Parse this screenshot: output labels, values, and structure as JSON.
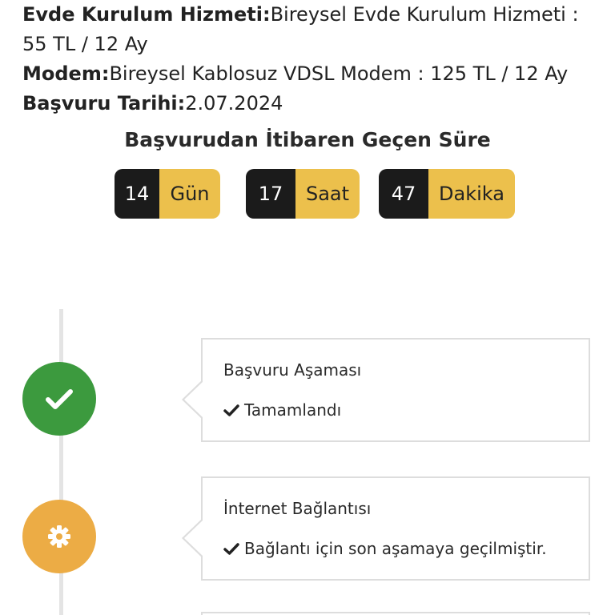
{
  "info": {
    "install_label": "Evde Kurulum Hizmeti:",
    "install_value": "Bireysel Evde Kurulum Hizmeti :",
    "install_value_cont": "55 TL / 12 Ay",
    "modem_label": "Modem:",
    "modem_value": "Bireysel Kablosuz VDSL Modem : 125 TL / 12 Ay",
    "date_label": "Başvuru Tarihi:",
    "date_value": "2.07.2024"
  },
  "elapsed": {
    "title": "Başvurudan İtibaren Geçen Süre",
    "days_value": "14",
    "days_unit": "Gün",
    "hours_value": "17",
    "hours_unit": "Saat",
    "minutes_value": "47",
    "minutes_unit": "Dakika"
  },
  "colors": {
    "completed": "#3c9a3e",
    "in_progress": "#ecac45",
    "timer_dark": "#1b1b1b",
    "timer_accent": "#ecc04c"
  },
  "steps": [
    {
      "title": "Başvuru Aşaması",
      "status": "Tamamlandı",
      "icon": "check-icon",
      "state": "completed"
    },
    {
      "title": "İnternet Bağlantısı",
      "status": "Bağlantı için son aşamaya geçilmiştir.",
      "icon": "gear-icon",
      "state": "in_progress"
    }
  ]
}
